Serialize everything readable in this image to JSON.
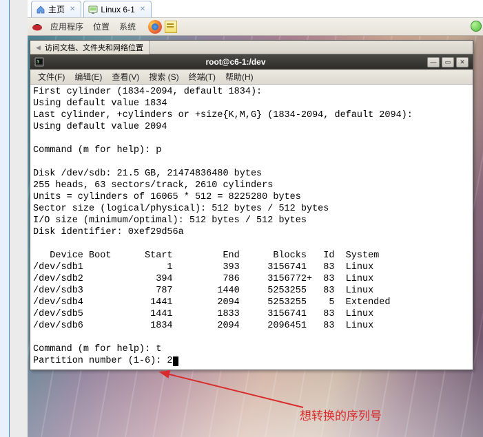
{
  "tabs": {
    "home": {
      "label": "主页"
    },
    "vm": {
      "label": "Linux 6-1"
    }
  },
  "gnome_panel": {
    "apps": "应用程序",
    "places": "位置",
    "system": "系统"
  },
  "terminal": {
    "tab_label": "访问文档、文件夹和网络位置",
    "title": "root@c6-1:/dev",
    "menus": {
      "file": "文件(F)",
      "edit": "编辑(E)",
      "view": "查看(V)",
      "search": "搜索 (S)",
      "terminal": "终端(T)",
      "help": "帮助(H)"
    },
    "lines": [
      "First cylinder (1834-2094, default 1834):",
      "Using default value 1834",
      "Last cylinder, +cylinders or +size{K,M,G} (1834-2094, default 2094):",
      "Using default value 2094",
      "",
      "Command (m for help): p",
      "",
      "Disk /dev/sdb: 21.5 GB, 21474836480 bytes",
      "255 heads, 63 sectors/track, 2610 cylinders",
      "Units = cylinders of 16065 * 512 = 8225280 bytes",
      "Sector size (logical/physical): 512 bytes / 512 bytes",
      "I/O size (minimum/optimal): 512 bytes / 512 bytes",
      "Disk identifier: 0xef29d56a",
      "",
      "   Device Boot      Start         End      Blocks   Id  System",
      "/dev/sdb1               1         393     3156741   83  Linux",
      "/dev/sdb2             394         786     3156772+  83  Linux",
      "/dev/sdb3             787        1440     5253255   83  Linux",
      "/dev/sdb4            1441        2094     5253255    5  Extended",
      "/dev/sdb5            1441        1833     3156741   83  Linux",
      "/dev/sdb6            1834        2094     2096451   83  Linux",
      "",
      "Command (m for help): t"
    ],
    "prompt_line_prefix": "Partition number (1-6): ",
    "prompt_input": "2"
  },
  "chart_data": {
    "type": "table",
    "title": "fdisk partition table for /dev/sdb",
    "columns": [
      "Device",
      "Boot",
      "Start",
      "End",
      "Blocks",
      "Id",
      "System"
    ],
    "rows": [
      [
        "/dev/sdb1",
        "",
        1,
        393,
        "3156741",
        "83",
        "Linux"
      ],
      [
        "/dev/sdb2",
        "",
        394,
        786,
        "3156772+",
        "83",
        "Linux"
      ],
      [
        "/dev/sdb3",
        "",
        787,
        1440,
        "5253255",
        "83",
        "Linux"
      ],
      [
        "/dev/sdb4",
        "",
        1441,
        2094,
        "5253255",
        "5",
        "Extended"
      ],
      [
        "/dev/sdb5",
        "",
        1441,
        1833,
        "3156741",
        "83",
        "Linux"
      ],
      [
        "/dev/sdb6",
        "",
        1834,
        2094,
        "2096451",
        "83",
        "Linux"
      ]
    ]
  },
  "annotation": {
    "text": "想转换的序列号"
  }
}
